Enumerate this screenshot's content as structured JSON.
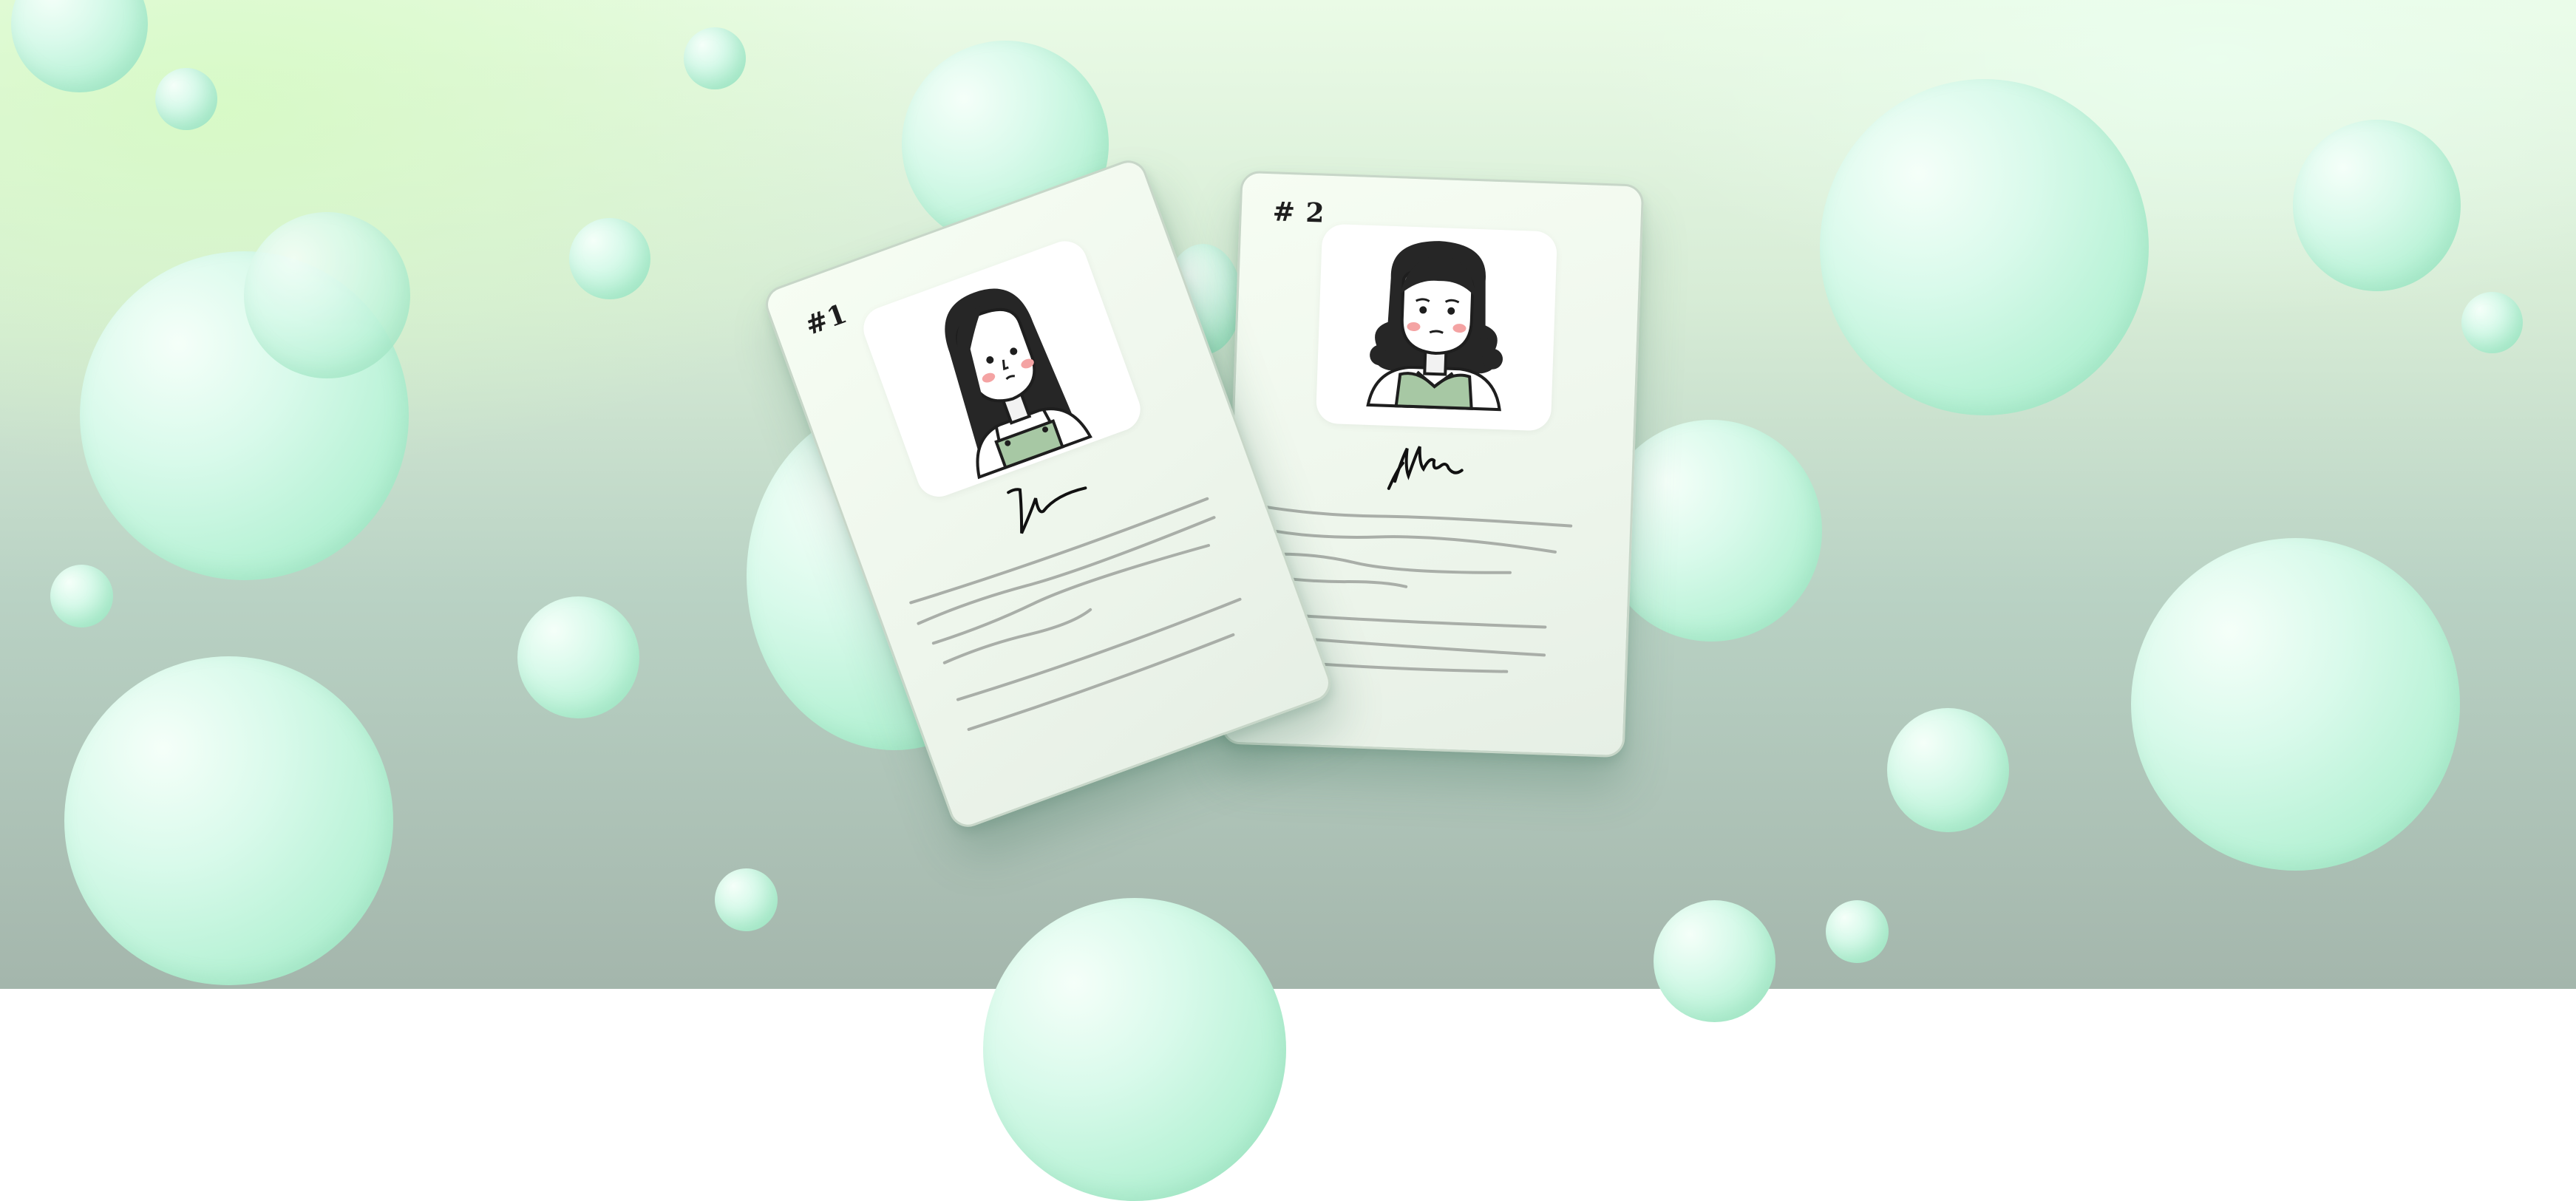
{
  "scene": {
    "description_free": true
  },
  "cards": [
    {
      "label": "#1",
      "avatar": "woman-with-long-black-hair-and-green-apron-icon",
      "signature": "signature-scribble-icon"
    },
    {
      "label": "# 2",
      "avatar": "woman-with-black-curly-hair-and-green-sweater-icon",
      "signature": "signature-scribble-icon"
    }
  ],
  "colors": {
    "bubble": "#b8f2d6",
    "accent_green": "#a7c8a4",
    "card": "#eef6ec",
    "ink": "#1e1e1e",
    "line_gray": "#a9aea8"
  }
}
